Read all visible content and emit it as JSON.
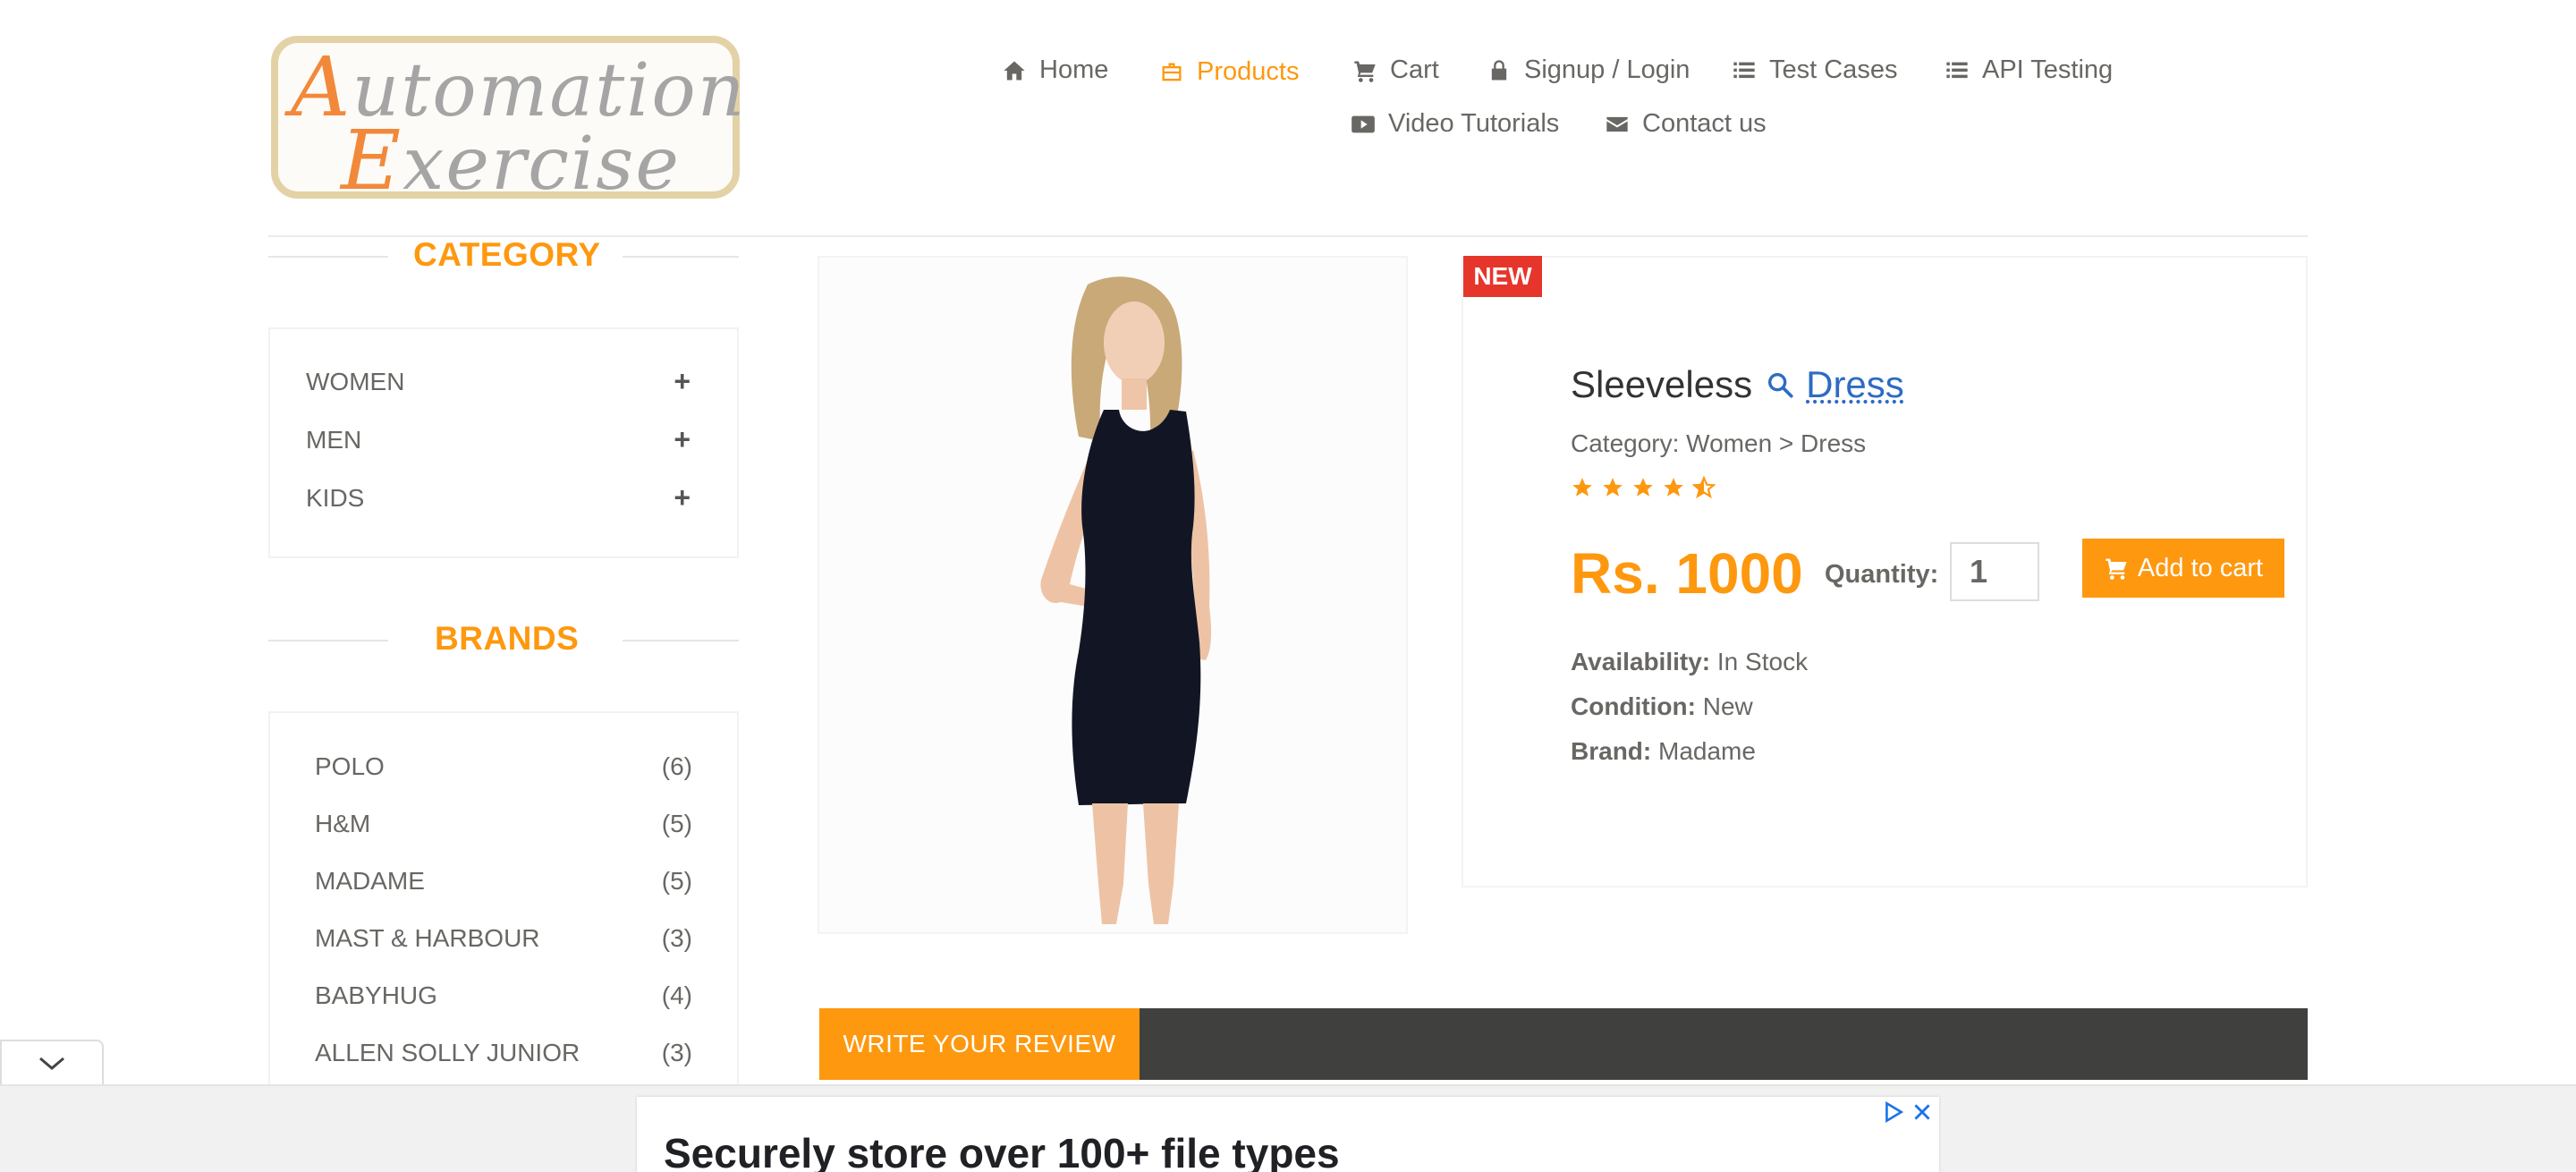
{
  "logo": {
    "line1_cap": "A",
    "line1_rest": "utomation",
    "line2_cap": "E",
    "line2_rest": "xercise"
  },
  "nav": {
    "items": [
      {
        "label": "Home",
        "icon": "home-icon"
      },
      {
        "label": "Products",
        "icon": "briefcase-icon",
        "active": true
      },
      {
        "label": "Cart",
        "icon": "cart-icon"
      },
      {
        "label": "Signup / Login",
        "icon": "lock-icon"
      },
      {
        "label": "Test Cases",
        "icon": "list-icon"
      },
      {
        "label": "API Testing",
        "icon": "list-icon"
      },
      {
        "label": "Video Tutorials",
        "icon": "youtube-play-icon"
      },
      {
        "label": "Contact us",
        "icon": "envelope-icon"
      }
    ]
  },
  "sidebar": {
    "category_title": "CATEGORY",
    "categories": [
      {
        "label": "WOMEN",
        "toggle": "+"
      },
      {
        "label": "MEN",
        "toggle": "+"
      },
      {
        "label": "KIDS",
        "toggle": "+"
      }
    ],
    "brands_title": "BRANDS",
    "brands": [
      {
        "name": "POLO",
        "count": "(6)"
      },
      {
        "name": "H&M",
        "count": "(5)"
      },
      {
        "name": "MADAME",
        "count": "(5)"
      },
      {
        "name": "MAST & HARBOUR",
        "count": "(3)"
      },
      {
        "name": "BABYHUG",
        "count": "(4)"
      },
      {
        "name": "ALLEN SOLLY JUNIOR",
        "count": "(3)"
      }
    ]
  },
  "product": {
    "badge": "NEW",
    "name_part1": "Sleeveless",
    "name_link": "Dress",
    "category": "Category: Women > Dress",
    "rating": 4.5,
    "price": "Rs. 1000",
    "quantity_label": "Quantity:",
    "quantity_value": "1",
    "add_to_cart": "Add to cart",
    "availability_label": "Availability:",
    "availability_value": "In Stock",
    "condition_label": "Condition:",
    "condition_value": "New",
    "brand_label": "Brand:",
    "brand_value": "Madame"
  },
  "review": {
    "tab_label": "WRITE YOUR REVIEW"
  },
  "ad": {
    "headline": "Securely store over 100+ file types"
  },
  "colors": {
    "accent": "#fe980f",
    "badge": "#e6352a",
    "link": "#2d6cc3",
    "review_bar": "#40403e"
  }
}
